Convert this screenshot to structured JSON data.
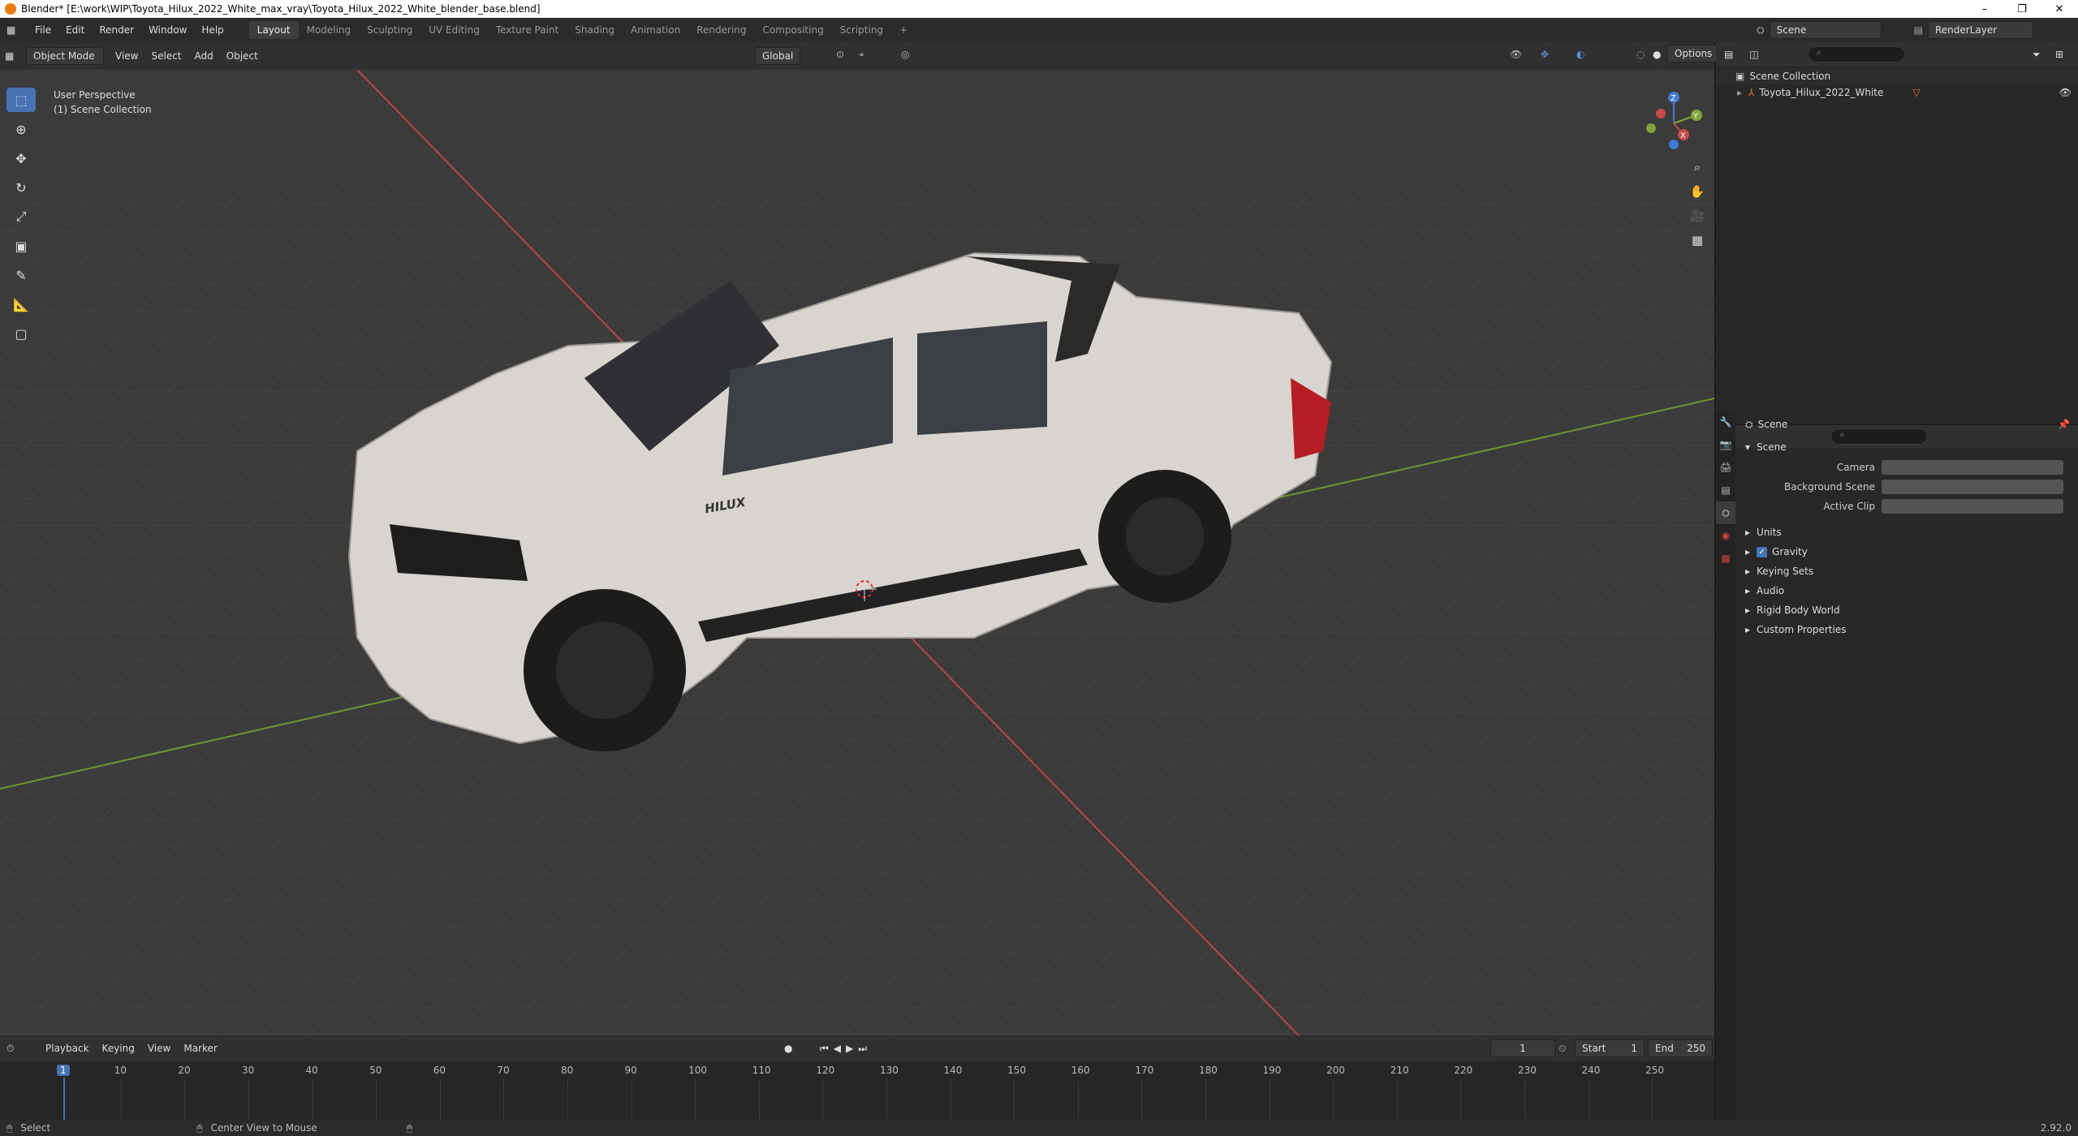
{
  "window": {
    "title": "Blender* [E:\\work\\WIP\\Toyota_Hilux_2022_White_max_vray\\Toyota_Hilux_2022_White_blender_base.blend]",
    "controls": [
      "–",
      "❐",
      "✕"
    ]
  },
  "menus": [
    "File",
    "Edit",
    "Render",
    "Window",
    "Help"
  ],
  "workspaces": [
    "Layout",
    "Modeling",
    "Sculpting",
    "UV Editing",
    "Texture Paint",
    "Shading",
    "Animation",
    "Rendering",
    "Compositing",
    "Scripting"
  ],
  "active_workspace": "Layout",
  "scene_selector": "Scene",
  "view_layer": "RenderLayer",
  "viewport": {
    "mode": "Object Mode",
    "menus": [
      "View",
      "Select",
      "Add",
      "Object"
    ],
    "transform_orientation": "Global",
    "options_label": "Options",
    "overlay_title": "User Perspective",
    "overlay_collection": "(1) Scene Collection",
    "vehicle_badge": "HILUX",
    "gizmo_axes": {
      "x": "X",
      "y": "Y",
      "z": "Z"
    }
  },
  "tools": [
    "select-box",
    "cursor",
    "move",
    "rotate",
    "scale",
    "transform",
    "annotate",
    "measure",
    "add-cube"
  ],
  "outliner": {
    "root": "Scene Collection",
    "items": [
      "Toyota_Hilux_2022_White"
    ]
  },
  "properties": {
    "scene_name": "Scene",
    "panel_title": "Scene",
    "fields": [
      {
        "label": "Camera",
        "value": ""
      },
      {
        "label": "Background Scene",
        "value": ""
      },
      {
        "label": "Active Clip",
        "value": ""
      }
    ],
    "subpanels": [
      "Units",
      "Gravity",
      "Keying Sets",
      "Audio",
      "Rigid Body World",
      "Custom Properties"
    ],
    "gravity_checked": true
  },
  "timeline": {
    "menus": [
      "Playback",
      "Keying",
      "View",
      "Marker"
    ],
    "current_frame": "1",
    "start_label": "Start",
    "start": "1",
    "end_label": "End",
    "end": "250",
    "ticks": [
      "1",
      "10",
      "20",
      "30",
      "40",
      "50",
      "60",
      "70",
      "80",
      "90",
      "100",
      "110",
      "120",
      "130",
      "140",
      "150",
      "160",
      "170",
      "180",
      "190",
      "200",
      "210",
      "220",
      "230",
      "240",
      "250"
    ]
  },
  "statusbar": {
    "left": "Select",
    "middle": "Center View to Mouse",
    "version": "2.92.0"
  },
  "colors": {
    "accent": "#4772b3",
    "x_axis": "#c64a4a",
    "y_axis": "#7fa33a",
    "z_axis": "#3d7ad6",
    "orange": "#e87d0d"
  }
}
